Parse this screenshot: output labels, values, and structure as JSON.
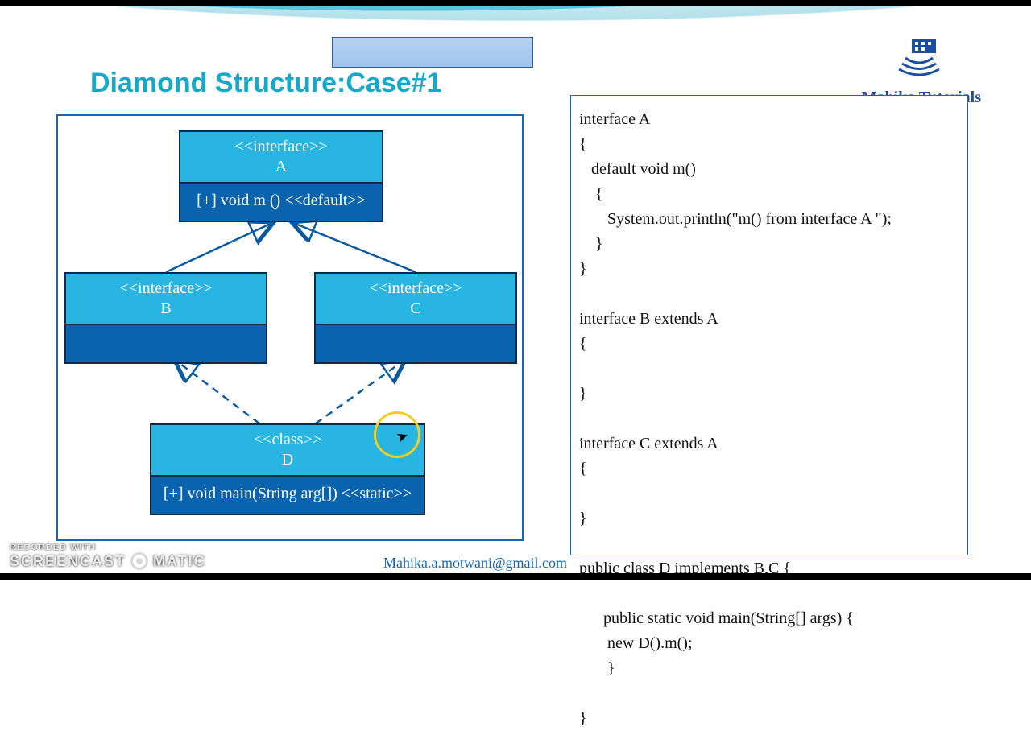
{
  "header": {
    "title": "Diamond Structure:Case#1",
    "brand": "Mahika Tutorials"
  },
  "footer": {
    "email": "Mahika.a.motwani@gmail.com",
    "watermark_line1": "RECORDED WITH",
    "watermark_brand_a": "SCREENCAST",
    "watermark_brand_b": "MATIC"
  },
  "diagram": {
    "boxA": {
      "stereo": "<<interface>>",
      "name": "A",
      "member": "[+] void  m () <<default>>"
    },
    "boxB": {
      "stereo": "<<interface>>",
      "name": "B",
      "member": ""
    },
    "boxC": {
      "stereo": "<<interface>>",
      "name": "C",
      "member": ""
    },
    "boxD": {
      "stereo": "<<class>>",
      "name": "D",
      "member": "[+] void  main(String arg[]) <<static>>"
    }
  },
  "code": "interface A\n{\n   default void m()\n    {\n       System.out.println(\"m() from interface A \");\n    }\n}\n\ninterface B extends A\n{\n\n}\n\ninterface C extends A\n{\n\n}\n\npublic class D implements B,C {\n\n      public static void main(String[] args) {\n       new D().m();\n       }\n\n}"
}
